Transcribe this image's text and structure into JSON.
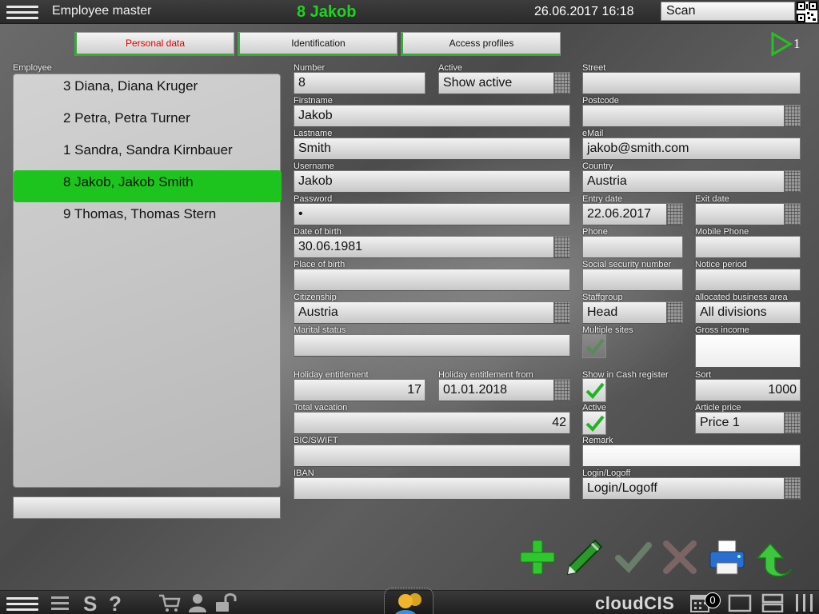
{
  "header": {
    "app_title": "Employee master",
    "record_title": "8 Jakob",
    "datetime": "26.06.2017 16:18",
    "scan_label": "Scan"
  },
  "tabs": [
    {
      "label": "Personal data",
      "active": true
    },
    {
      "label": "Identification",
      "active": false
    },
    {
      "label": "Access profiles",
      "active": false
    }
  ],
  "pager": {
    "count": "1"
  },
  "employee_list": {
    "label": "Employee",
    "items": [
      {
        "label": "3 Diana, Diana Kruger",
        "selected": false
      },
      {
        "label": "2 Petra, Petra Turner",
        "selected": false
      },
      {
        "label": "1 Sandra, Sandra Kirnbauer",
        "selected": false
      },
      {
        "label": "8 Jakob, Jakob Smith",
        "selected": true
      },
      {
        "label": "9 Thomas, Thomas Stern",
        "selected": false
      }
    ]
  },
  "form": {
    "number": {
      "label": "Number",
      "value": "8"
    },
    "active_filter": {
      "label": "Active",
      "value": "Show active"
    },
    "firstname": {
      "label": "Firstname",
      "value": "Jakob"
    },
    "lastname": {
      "label": "Lastname",
      "value": "Smith"
    },
    "username": {
      "label": "Username",
      "value": "Jakob"
    },
    "password": {
      "label": "Password",
      "value": "•"
    },
    "date_of_birth": {
      "label": "Date of birth",
      "value": "30.06.1981"
    },
    "place_of_birth": {
      "label": "Place of birth",
      "value": ""
    },
    "citizenship": {
      "label": "Citizenship",
      "value": "Austria"
    },
    "marital_status": {
      "label": "Marital status",
      "value": ""
    },
    "holiday_entitlement": {
      "label": "Holiday entitlement",
      "value": "17"
    },
    "holiday_entitlement_from": {
      "label": "Holiday entitlement from",
      "value": "01.01.2018"
    },
    "total_vacation": {
      "label": "Total vacation",
      "value": "42"
    },
    "bic": {
      "label": "BIC/SWIFT",
      "value": ""
    },
    "iban": {
      "label": "IBAN",
      "value": ""
    },
    "street": {
      "label": "Street",
      "value": ""
    },
    "postcode": {
      "label": "Postcode",
      "value": ""
    },
    "email": {
      "label": "eMail",
      "value": "jakob@smith.com"
    },
    "country": {
      "label": "Country",
      "value": "Austria"
    },
    "entry_date": {
      "label": "Entry date",
      "value": "22.06.2017"
    },
    "exit_date": {
      "label": "Exit date",
      "value": ""
    },
    "phone": {
      "label": "Phone",
      "value": ""
    },
    "mobile_phone": {
      "label": "Mobile Phone",
      "value": ""
    },
    "ssn": {
      "label": "Social security number",
      "value": ""
    },
    "notice_period": {
      "label": "Notice period",
      "value": ""
    },
    "staffgroup": {
      "label": "Staffgroup",
      "value": "Head"
    },
    "business_area": {
      "label": "allocated business area",
      "value": "All divisions"
    },
    "multiple_sites": {
      "label": "Multiple sites",
      "checked": true
    },
    "gross_income": {
      "label": "Gross income",
      "value": ""
    },
    "show_in_cash_register": {
      "label": "Show in Cash register",
      "checked": true
    },
    "sort": {
      "label": "Sort",
      "value": "1000"
    },
    "active": {
      "label": "Active",
      "checked": true
    },
    "article_price": {
      "label": "Article price",
      "value": "Price 1"
    },
    "remark": {
      "label": "Remark",
      "value": ""
    },
    "login_logoff": {
      "label": "Login/Logoff",
      "value": "Login/Logoff"
    }
  },
  "footer": {
    "brand": "cloudCIS",
    "cart_count": "0",
    "s_label": "S",
    "help_label": "?"
  },
  "colors": {
    "accent_green": "#1ec41e",
    "active_tab_text": "#e00000",
    "title_green": "#1fd31f"
  }
}
